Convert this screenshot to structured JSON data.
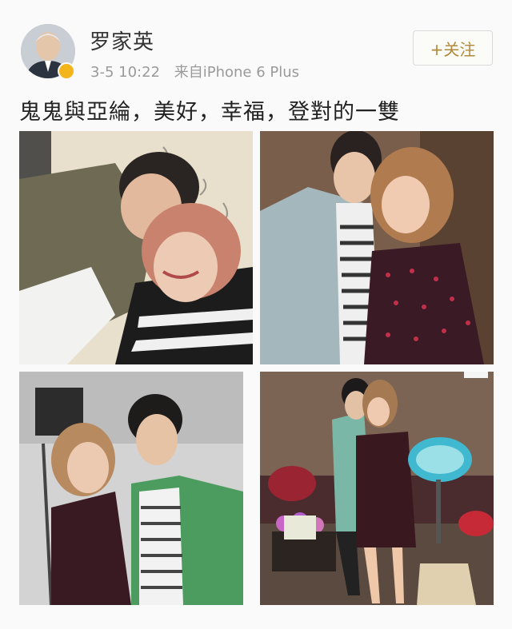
{
  "post": {
    "username": "罗家英",
    "timestamp": "3-5 10:22",
    "source": "来自iPhone 6 Plus",
    "follow_label": "+关注",
    "text": "鬼鬼與亞綸，美好，幸福，登對的一雙"
  },
  "colors": {
    "accent": "#b08a3a",
    "verified_badge": "#f3b51b",
    "meta_text": "#9a9a9a"
  },
  "photos": [
    {
      "id": "photo-1"
    },
    {
      "id": "photo-2"
    },
    {
      "id": "photo-3"
    },
    {
      "id": "photo-4"
    }
  ]
}
